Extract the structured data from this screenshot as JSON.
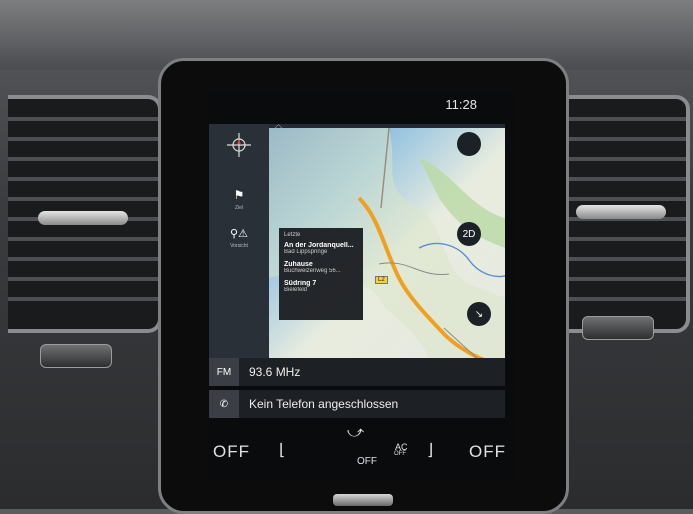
{
  "status_bar": {
    "time": "11:28"
  },
  "map": {
    "sidebar": {
      "compass_icon": "compass-icon",
      "destination_label": "Ziel",
      "destination_icon": "checkered-flag-icon",
      "warning_label": "Vorsicht",
      "warning_icon": "pin-warning-icon"
    },
    "view_mode": "2D",
    "road_badge": "L2",
    "recent": {
      "header": "Letzte",
      "items": [
        {
          "name": "An der Jordanquell...",
          "sub": "Bad Lippspringe"
        },
        {
          "name": "Zuhause",
          "sub": "Buchweizenweg 56..."
        },
        {
          "name": "Südring 7",
          "sub": "Bielefeld"
        }
      ]
    }
  },
  "radio": {
    "icon_label": "FM",
    "frequency": "93.6 MHz"
  },
  "phone": {
    "status": "Kein Telefon angeschlossen"
  },
  "climate": {
    "left_fan": "OFF",
    "center_fan": "OFF",
    "ac_label_top": "AC",
    "ac_label_bottom": "OFF",
    "right_fan": "OFF"
  }
}
